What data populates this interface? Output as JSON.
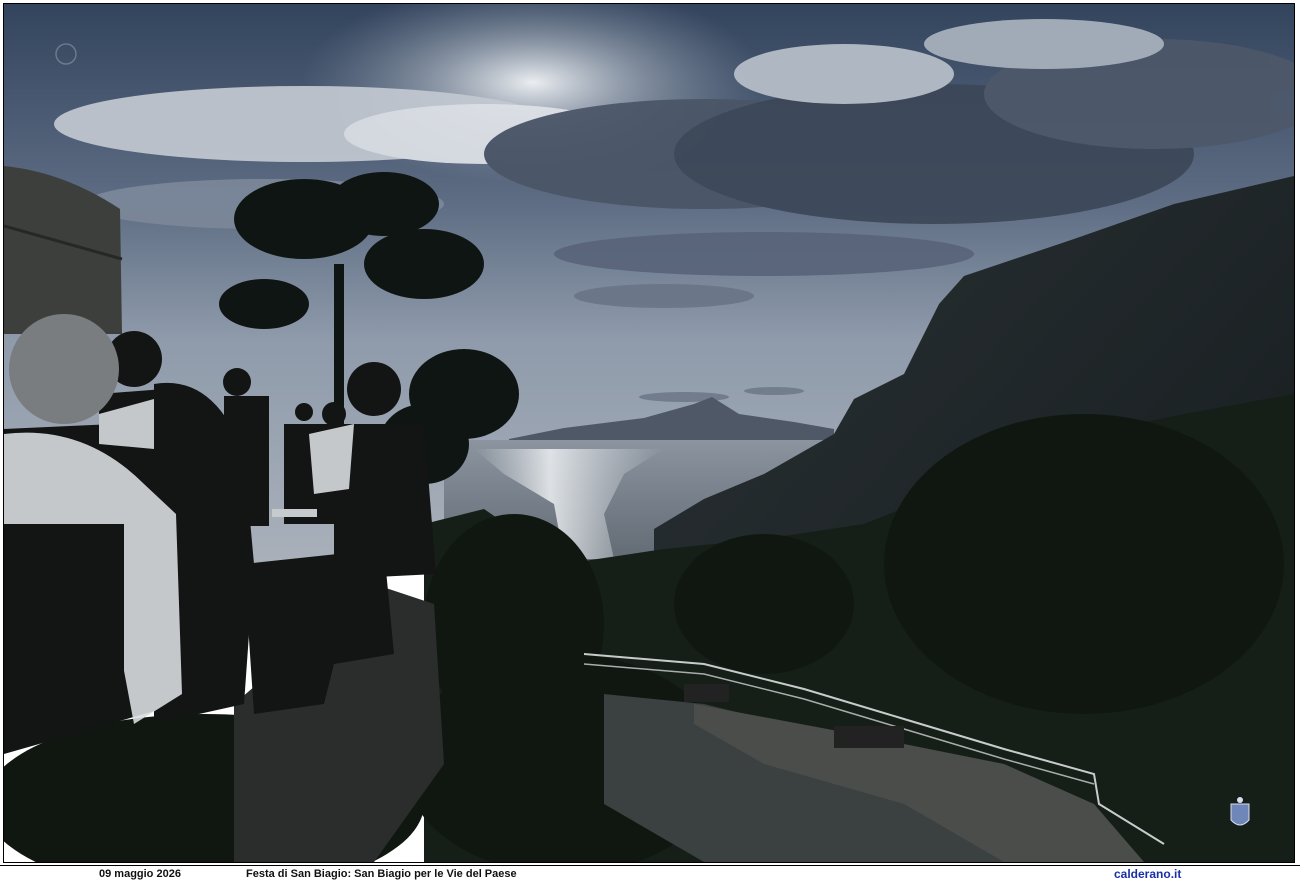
{
  "photo": {
    "subject": "sunset-over-bay-with-mountain-and-spectators"
  },
  "caption": {
    "date": "09 maggio 2026",
    "title": "Festa di San Biagio: San Biagio per le Vie del Paese",
    "site": "calderano.it"
  },
  "colors": {
    "sky_top": "#2e3f57",
    "sky_mid": "#7f8ea3",
    "sea": "#9aa3ae",
    "mountain": "#1b2226",
    "foliage": "#121a14",
    "site_link": "#1a2fa8"
  }
}
